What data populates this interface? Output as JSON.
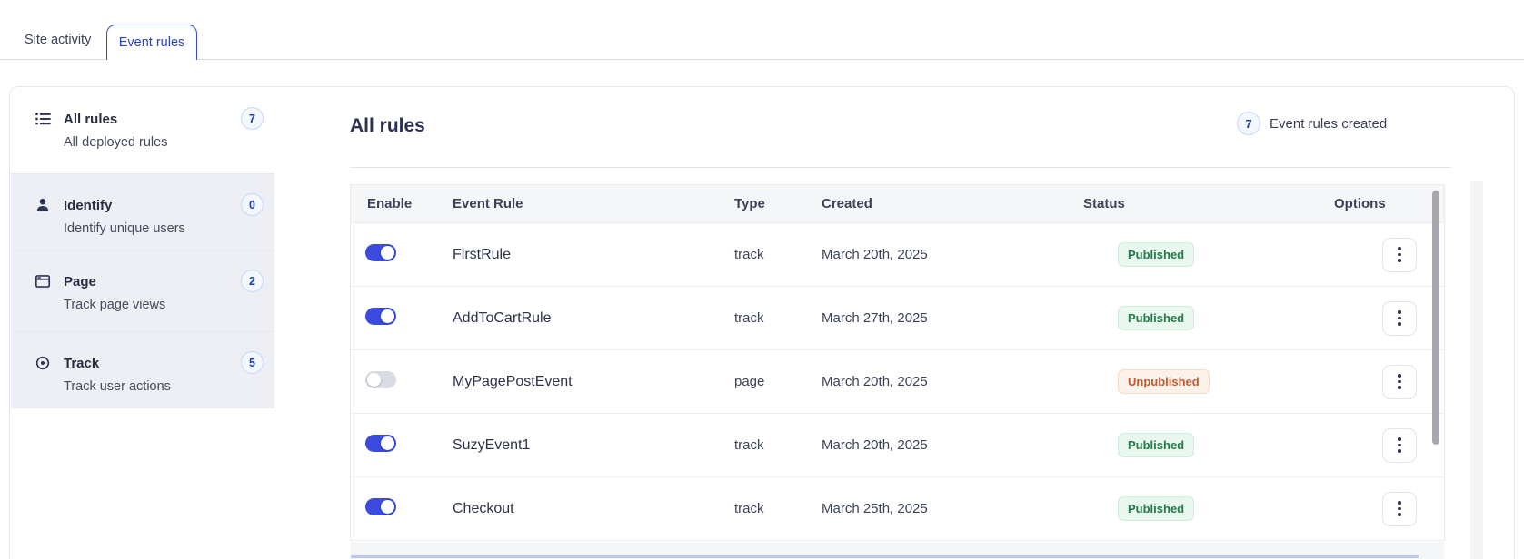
{
  "tabs": {
    "site_activity": "Site activity",
    "event_rules": "Event rules"
  },
  "sidebar": {
    "items": [
      {
        "label": "All rules",
        "description": "All deployed rules",
        "count": "7",
        "icon": "list-icon",
        "active": true
      },
      {
        "label": "Identify",
        "description": "Identify unique users",
        "count": "0",
        "icon": "user-icon",
        "active": false
      },
      {
        "label": "Page",
        "description": "Track page views",
        "count": "2",
        "icon": "window-icon",
        "active": false
      },
      {
        "label": "Track",
        "description": "Track user actions",
        "count": "5",
        "icon": "target-icon",
        "active": false
      }
    ]
  },
  "main": {
    "title": "All rules",
    "summary": {
      "count": "7",
      "label": "Event rules created"
    },
    "table": {
      "headers": {
        "enable": "Enable",
        "event_rule": "Event Rule",
        "type": "Type",
        "created": "Created",
        "status": "Status",
        "options": "Options"
      },
      "rows": [
        {
          "name": "FirstRule",
          "type": "track",
          "created": "March 20th, 2025",
          "status": "Published",
          "status_kind": "published",
          "toggle": "on"
        },
        {
          "name": "AddToCartRule",
          "type": "track",
          "created": "March 27th, 2025",
          "status": "Published",
          "status_kind": "published",
          "toggle": "on"
        },
        {
          "name": "MyPagePostEvent",
          "type": "page",
          "created": "March 20th, 2025",
          "status": "Unpublished",
          "status_kind": "unpublished",
          "toggle": "off"
        },
        {
          "name": "SuzyEvent1",
          "type": "track",
          "created": "March 20th, 2025",
          "status": "Published",
          "status_kind": "published",
          "toggle": "on"
        },
        {
          "name": "Checkout",
          "type": "track",
          "created": "March 25th, 2025",
          "status": "Published",
          "status_kind": "published",
          "toggle": "on"
        }
      ]
    }
  },
  "colors": {
    "accent_blue": "#2843d4",
    "toggle_on": "#3a4bdd",
    "published_text": "#217a47",
    "unpublished_text": "#bd5b32",
    "header_bg": "#f5f6f8"
  }
}
